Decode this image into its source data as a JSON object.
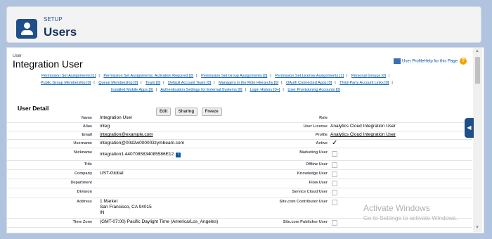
{
  "header": {
    "setup_label": "SETUP",
    "title": "Users"
  },
  "record": {
    "object_label": "User",
    "name": "Integration User"
  },
  "help": {
    "link_text": "User ProfileHelp for this Page"
  },
  "related_lists": [
    [
      "Permission Set Assignments [1]",
      "Permission Set Assignments: Activation Required [0]",
      "Permission Set Group Assignments [0]",
      "Permission Set License Assignments [1]",
      "Personal Groups [0]"
    ],
    [
      "Public Group Membership [0]",
      "Queue Membership [0]",
      "Team [0]",
      "Default Account Team [0]",
      "Managers in the Role Hierarchy [0]",
      "OAuth Connected Apps [0]",
      "Third-Party Account Links [0]"
    ],
    [
      "Installed Mobile Apps [0]",
      "Authentication Settings for External Systems [0]",
      "Login History [0+]",
      "User Provisioning Accounts [0]"
    ]
  ],
  "detail": {
    "title": "User Detail",
    "buttons": {
      "edit": "Edit",
      "sharing": "Sharing",
      "freeze": "Freeze"
    },
    "rows": [
      {
        "l_label": "Name",
        "l_value": "Integration User",
        "r_label": "Role",
        "r_value": ""
      },
      {
        "l_label": "Alias",
        "l_value": "integ",
        "r_label": "User License",
        "r_value": "Analytics Cloud Integration User"
      },
      {
        "l_label": "Email",
        "l_value": "integration@example.com",
        "r_label": "Profile",
        "r_value": "Analytics Cloud Integration User"
      },
      {
        "l_label": "Username",
        "l_value": "integration@00d2w000003zymbeam.com",
        "r_label": "Active",
        "r_value": "✓"
      },
      {
        "l_label": "Nickname",
        "l_value": "integration1.4407085834085586E12",
        "r_label": "Marketing User",
        "r_value": ""
      },
      {
        "l_label": "Title",
        "l_value": "",
        "r_label": "Offline User",
        "r_value": ""
      },
      {
        "l_label": "Company",
        "l_value": "UST-Global",
        "r_label": "Knowledge User",
        "r_value": ""
      },
      {
        "l_label": "Department",
        "l_value": "",
        "r_label": "Flow User",
        "r_value": ""
      },
      {
        "l_label": "Division",
        "l_value": "",
        "r_label": "Service Cloud User",
        "r_value": ""
      },
      {
        "l_label": "Address",
        "l_value_lines": [
          "1 Market",
          "San Francisco, CA 94015",
          "IN"
        ],
        "r_label": "Site.com Contributor User",
        "r_value": ""
      },
      {
        "l_label": "Time Zone",
        "l_value": "(GMT-07:00) Pacific Daylight Time (America/Los_Angeles)",
        "r_label": "Site.com Publisher User",
        "r_value": ""
      }
    ]
  },
  "watermark": {
    "line1": "Activate Windows",
    "line2": "Go to Settings to activate Windows."
  }
}
